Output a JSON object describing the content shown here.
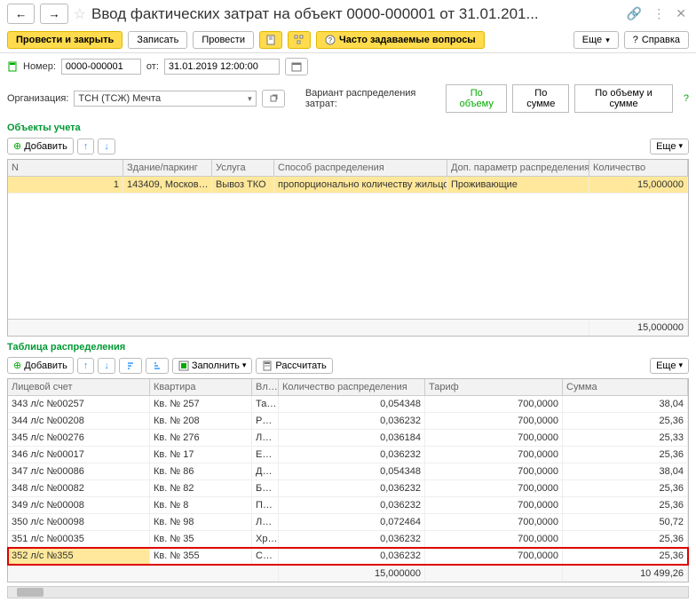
{
  "header": {
    "title": "Ввод фактических затрат на объект 0000-000001 от 31.01.201..."
  },
  "toolbar": {
    "post_close": "Провести и закрыть",
    "save": "Записать",
    "post": "Провести",
    "faq": "Часто задаваемые вопросы",
    "more": "Еще",
    "help": "Справка"
  },
  "form": {
    "number_label": "Номер:",
    "number_value": "0000-000001",
    "from_label": "от:",
    "date_value": "31.01.2019 12:00:00",
    "org_label": "Организация:",
    "org_value": "ТСН (ТСЖ) Мечта",
    "dist_label": "Вариант распределения затрат:",
    "dist_volume": "По объему",
    "dist_sum": "По сумме",
    "dist_both": "По объему и сумме"
  },
  "section1": {
    "title": "Объекты учета",
    "add": "Добавить",
    "more": "Еще",
    "cols": {
      "n": "N",
      "building": "Здание/паркинг",
      "service": "Услуга",
      "method": "Способ распределения",
      "param": "Доп. параметр распределения",
      "qty": "Количество"
    },
    "row": {
      "n": "1",
      "building": "143409, Москов…",
      "service": "Вывоз ТКО",
      "method": "пропорционально количеству жильцов",
      "param": "Проживающие",
      "qty": "15,000000"
    },
    "footer_qty": "15,000000"
  },
  "section2": {
    "title": "Таблица распределения",
    "add": "Добавить",
    "fill": "Заполнить",
    "calc": "Рассчитать",
    "more": "Еще",
    "cols": {
      "account": "Лицевой счет",
      "flat": "Квартира",
      "owner": "Вл…",
      "qty": "Количество распределения",
      "tariff": "Тариф",
      "sum": "Сумма"
    },
    "rows": [
      {
        "account": "343 л/с №00257",
        "flat": "Кв. № 257",
        "owner": "Та…",
        "qty": "0,054348",
        "tariff": "700,0000",
        "sum": "38,04"
      },
      {
        "account": "344 л/с №00208",
        "flat": "Кв. № 208",
        "owner": "Р…",
        "qty": "0,036232",
        "tariff": "700,0000",
        "sum": "25,36"
      },
      {
        "account": "345 л/с №00276",
        "flat": "Кв. № 276",
        "owner": "Л…",
        "qty": "0,036184",
        "tariff": "700,0000",
        "sum": "25,33"
      },
      {
        "account": "346 л/с №00017",
        "flat": "Кв. № 17",
        "owner": "Е…",
        "qty": "0,036232",
        "tariff": "700,0000",
        "sum": "25,36"
      },
      {
        "account": "347 л/с №00086",
        "flat": "Кв. № 86",
        "owner": "Д…",
        "qty": "0,054348",
        "tariff": "700,0000",
        "sum": "38,04"
      },
      {
        "account": "348 л/с №00082",
        "flat": "Кв. № 82",
        "owner": "Б…",
        "qty": "0,036232",
        "tariff": "700,0000",
        "sum": "25,36"
      },
      {
        "account": "349 л/с №00008",
        "flat": "Кв. № 8",
        "owner": "П…",
        "qty": "0,036232",
        "tariff": "700,0000",
        "sum": "25,36"
      },
      {
        "account": "350 л/с №00098",
        "flat": "Кв. № 98",
        "owner": "Л…",
        "qty": "0,072464",
        "tariff": "700,0000",
        "sum": "50,72"
      },
      {
        "account": "351 л/с №00035",
        "flat": "Кв. № 35",
        "owner": "Хр…",
        "qty": "0,036232",
        "tariff": "700,0000",
        "sum": "25,36"
      },
      {
        "account": "352 л/с №355",
        "flat": "Кв. № 355",
        "owner": "С…",
        "qty": "0,036232",
        "tariff": "700,0000",
        "sum": "25,36"
      }
    ],
    "footer_qty": "15,000000",
    "footer_sum": "10 499,26"
  }
}
